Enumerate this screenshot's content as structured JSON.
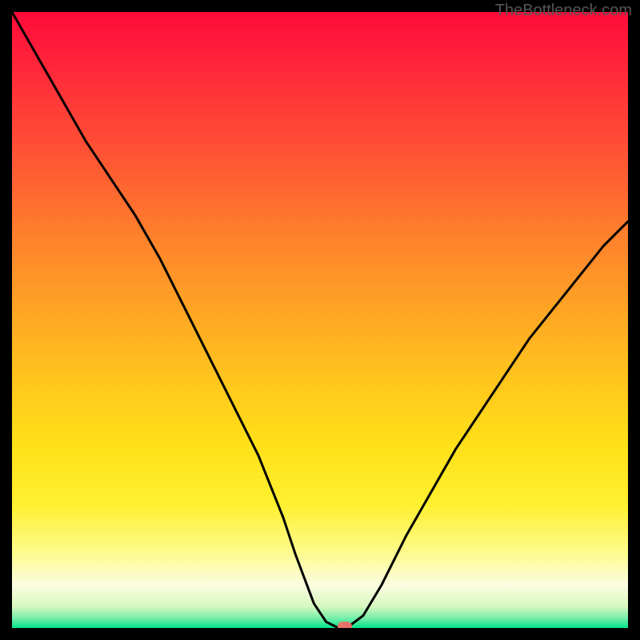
{
  "watermark": "TheBottleneck.com",
  "gradient": {
    "stops": [
      {
        "offset": 0.0,
        "color": "#ff0a3a"
      },
      {
        "offset": 0.1,
        "color": "#ff2a3a"
      },
      {
        "offset": 0.25,
        "color": "#ff5a33"
      },
      {
        "offset": 0.4,
        "color": "#ff8c2a"
      },
      {
        "offset": 0.55,
        "color": "#ffb820"
      },
      {
        "offset": 0.7,
        "color": "#ffe018"
      },
      {
        "offset": 0.8,
        "color": "#fff030"
      },
      {
        "offset": 0.88,
        "color": "#fdfb90"
      },
      {
        "offset": 0.93,
        "color": "#fafde0"
      },
      {
        "offset": 0.965,
        "color": "#d8f8c0"
      },
      {
        "offset": 0.985,
        "color": "#70eea8"
      },
      {
        "offset": 1.0,
        "color": "#00e488"
      }
    ]
  },
  "chart_data": {
    "type": "line",
    "title": "",
    "xlabel": "",
    "ylabel": "",
    "xlim": [
      0,
      100
    ],
    "ylim": [
      0,
      100
    ],
    "series": [
      {
        "name": "bottleneck-curve",
        "x": [
          0,
          4,
          8,
          12,
          16,
          20,
          24,
          28,
          32,
          36,
          40,
          44,
          46,
          49,
          51,
          53,
          55,
          57,
          60,
          64,
          68,
          72,
          76,
          80,
          84,
          88,
          92,
          96,
          100
        ],
        "y": [
          100,
          93,
          86,
          79,
          73,
          67,
          60,
          52,
          44,
          36,
          28,
          18,
          12,
          4,
          1,
          0,
          0.5,
          2,
          7,
          15,
          22,
          29,
          35,
          41,
          47,
          52,
          57,
          62,
          66
        ]
      }
    ],
    "marker": {
      "x": 54,
      "y": 0.2,
      "color": "#e5736a"
    }
  }
}
